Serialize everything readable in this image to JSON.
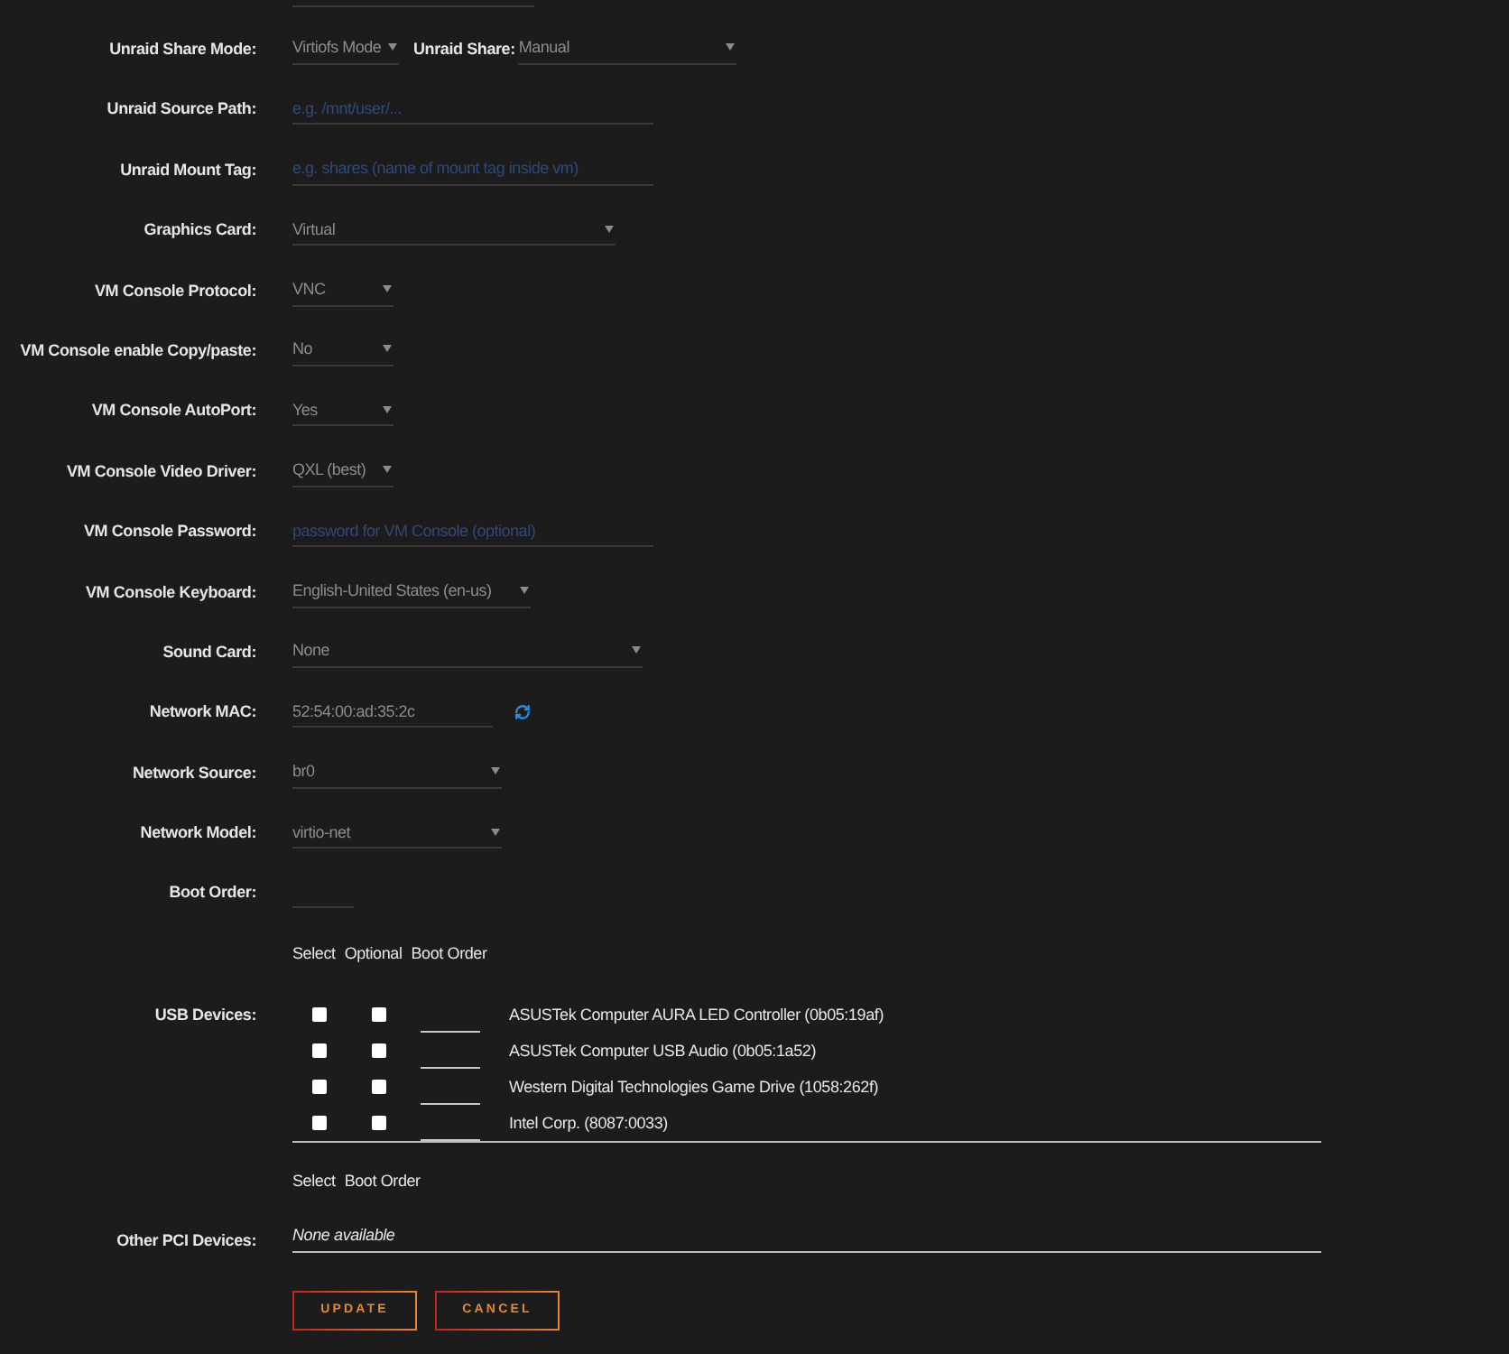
{
  "fields": [
    {
      "kind": "share",
      "label": "Unraid Share Mode:",
      "value": "Virtiofs Mode",
      "share_label": "Unraid Share:",
      "share_value": "Manual"
    },
    {
      "kind": "input",
      "label": "Unraid Source Path:",
      "placeholder": "e.g. /mnt/user/..."
    },
    {
      "kind": "input",
      "label": "Unraid Mount Tag:",
      "placeholder": "e.g. shares (name of mount tag inside vm)"
    },
    {
      "kind": "select",
      "label": "Graphics Card:",
      "value": "Virtual"
    },
    {
      "kind": "select",
      "label": "VM Console Protocol:",
      "value": "VNC"
    },
    {
      "kind": "select",
      "label": "VM Console enable Copy/paste:",
      "value": "No"
    },
    {
      "kind": "select",
      "label": "VM Console AutoPort:",
      "value": "Yes"
    },
    {
      "kind": "select",
      "label": "VM Console Video Driver:",
      "value": "QXL (best)"
    },
    {
      "kind": "input",
      "label": "VM Console Password:",
      "placeholder": "password for VM Console (optional)"
    },
    {
      "kind": "select",
      "label": "VM Console Keyboard:",
      "value": "English-United States (en-us)"
    },
    {
      "kind": "select",
      "label": "Sound Card:",
      "value": "None"
    },
    {
      "kind": "mac",
      "label": "Network MAC:",
      "value": "52:54:00:ad:35:2c"
    },
    {
      "kind": "select",
      "label": "Network Source:",
      "value": "br0"
    },
    {
      "kind": "select",
      "label": "Network Model:",
      "value": "virtio-net"
    },
    {
      "kind": "input",
      "label": "Boot Order:"
    }
  ],
  "usb": {
    "headers": [
      "Select",
      "Optional",
      "Boot Order"
    ],
    "label": "USB Devices:",
    "devices": [
      {
        "name": "ASUSTek Computer AURA LED Controller (0b05:19af)",
        "select_checked": false,
        "optional_checked": false
      },
      {
        "name": "ASUSTek Computer USB Audio (0b05:1a52)",
        "select_checked": false,
        "optional_checked": false
      },
      {
        "name": "Western Digital Technologies Game Drive (1058:262f)",
        "select_checked": false,
        "optional_checked": false
      },
      {
        "name": "Intel Corp. (8087:0033)",
        "select_checked": false,
        "optional_checked": false
      }
    ]
  },
  "pci": {
    "headers": [
      "Select",
      "Boot Order"
    ],
    "label": "Other PCI Devices:",
    "empty_text": "None available"
  },
  "buttons": [
    {
      "label": "UPDATE"
    },
    {
      "label": "CANCEL"
    }
  ]
}
